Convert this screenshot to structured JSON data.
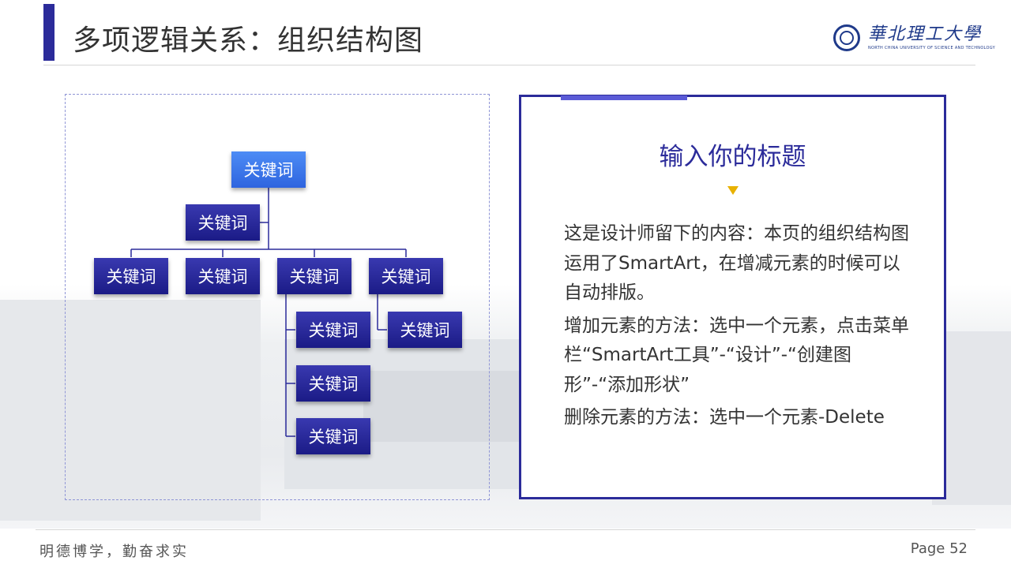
{
  "header": {
    "title": "多项逻辑关系：组织结构图",
    "logo_name": "華北理工大學",
    "logo_subtitle": "NORTH CHINA UNIVERSITY OF SCIENCE AND TECHNOLOGY"
  },
  "org_chart": {
    "root": "关键词",
    "assistant": "关键词",
    "level2": [
      "关键词",
      "关键词",
      "关键词",
      "关键词"
    ],
    "children_of_3": [
      "关键词",
      "关键词",
      "关键词"
    ],
    "children_of_4": [
      "关键词"
    ]
  },
  "card": {
    "title": "输入你的标题",
    "paragraphs": [
      "这是设计师留下的内容：本页的组织结构图运用了SmartArt，在增减元素的时候可以自动排版。",
      "增加元素的方法：选中一个元素，点击菜单栏“SmartArt工具”-“设计”-“创建图形”-“添加形状”",
      "删除元素的方法：选中一个元素-Delete"
    ]
  },
  "footer": {
    "motto": "明德博学，勤奋求实",
    "page": "Page 52"
  },
  "colors": {
    "accent": "#2b2b9a",
    "node": "#1f1f8c",
    "root_node": "#3a74e8",
    "marker": "#e8b100"
  }
}
